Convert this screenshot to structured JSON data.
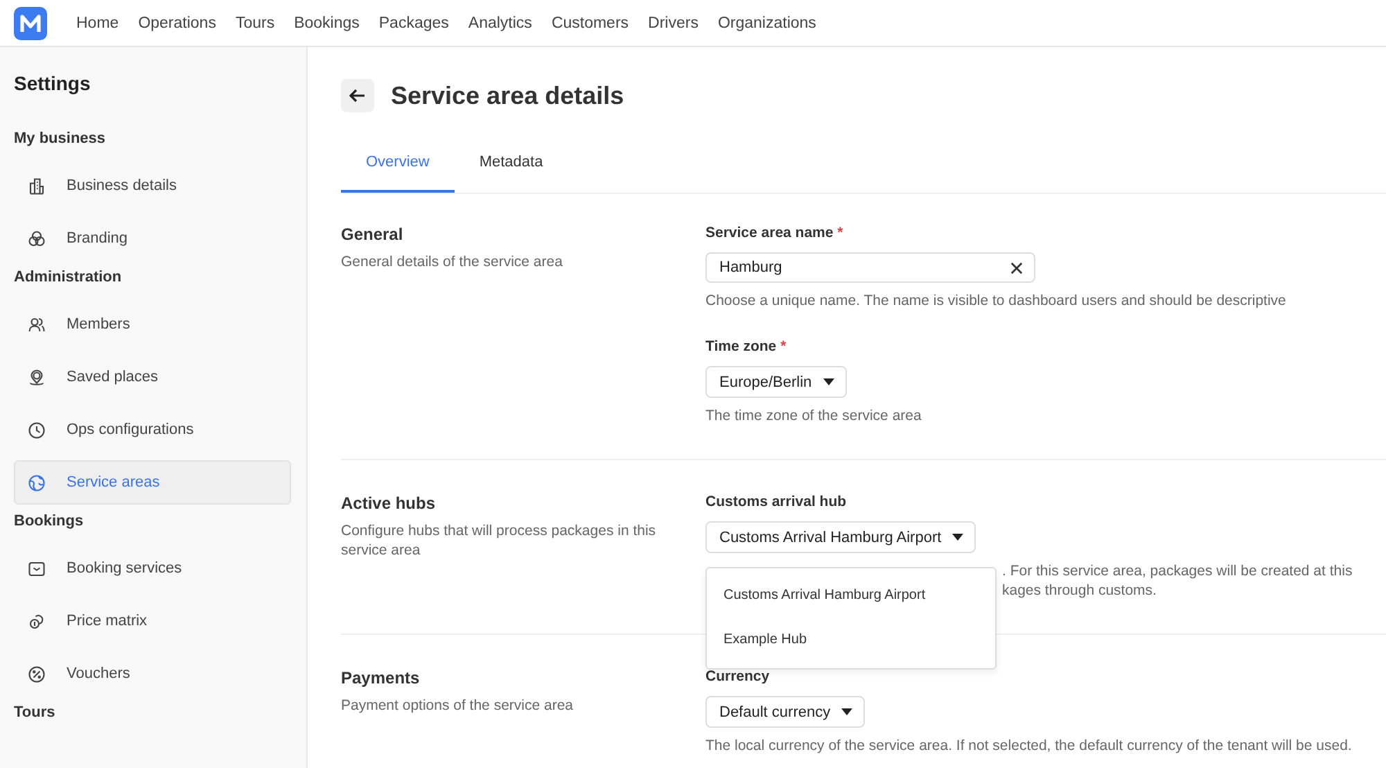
{
  "nav": {
    "items": [
      {
        "label": "Home",
        "selected": false
      },
      {
        "label": "Operations",
        "selected": false
      },
      {
        "label": "Tours",
        "selected": false
      },
      {
        "label": "Bookings",
        "selected": false
      },
      {
        "label": "Packages",
        "selected": false
      },
      {
        "label": "Analytics",
        "selected": false
      },
      {
        "label": "Customers",
        "selected": false
      },
      {
        "label": "Drivers",
        "selected": false
      },
      {
        "label": "Organizations",
        "selected": false
      }
    ]
  },
  "sidebar": {
    "title": "Settings",
    "groups": [
      {
        "heading": "My business",
        "items": [
          {
            "label": "Business details",
            "selected": false
          },
          {
            "label": "Branding",
            "selected": false
          }
        ]
      },
      {
        "heading": "Administration",
        "items": [
          {
            "label": "Members",
            "selected": false
          },
          {
            "label": "Saved places",
            "selected": false
          },
          {
            "label": "Ops configurations",
            "selected": false
          },
          {
            "label": "Service areas",
            "selected": true
          }
        ]
      },
      {
        "heading": "Bookings",
        "items": [
          {
            "label": "Booking services",
            "selected": false
          },
          {
            "label": "Price matrix",
            "selected": false
          },
          {
            "label": "Vouchers",
            "selected": false
          }
        ]
      },
      {
        "heading": "Tours"
      }
    ]
  },
  "page": {
    "title": "Service area details"
  },
  "tabs": [
    {
      "label": "Overview",
      "selected": true
    },
    {
      "label": "Metadata",
      "selected": false
    }
  ],
  "sections": [
    {
      "title": "General",
      "description": "General details of the service area",
      "fields": [
        {
          "kind": "text",
          "label": "Service area name",
          "required_mark": "*",
          "value": "Hamburg",
          "help": [
            "Choose a unique name. The name is visible to dashboard users and should be descriptive"
          ]
        },
        {
          "kind": "select",
          "label": "Time zone",
          "required_mark": "*",
          "value": "Europe/Berlin",
          "help": [
            "The time zone of the service area"
          ]
        }
      ]
    },
    {
      "title": "Active hubs",
      "description": "Configure hubs that will process packages in this service area",
      "fields": [
        {
          "kind": "select",
          "label": "Customs arrival hub",
          "value": "Customs Arrival Hamburg Airport",
          "help": [
            ". For this service area, packages will be created at this",
            "kages through customs."
          ],
          "menu": [
            "Customs Arrival Hamburg Airport",
            "Example Hub"
          ]
        }
      ]
    },
    {
      "title": "Payments",
      "description": "Payment options of the service area",
      "fields": [
        {
          "kind": "select",
          "label": "Currency",
          "value": "Default currency",
          "help": [
            "The local currency of the service area. If not selected, the default currency of the tenant will be used."
          ]
        }
      ]
    }
  ]
}
